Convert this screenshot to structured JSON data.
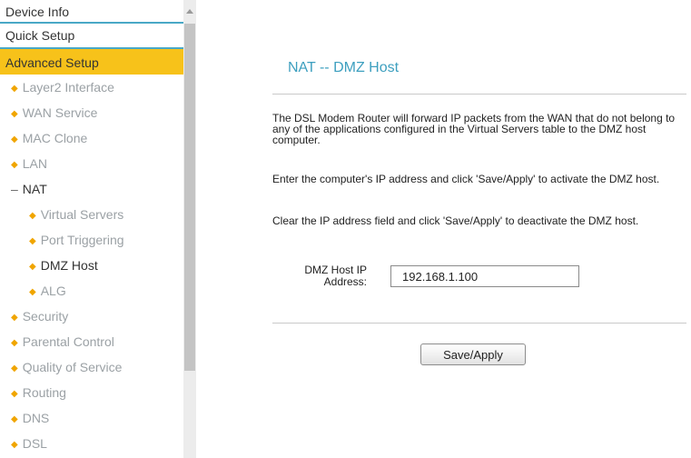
{
  "sidebar": {
    "top_items": [
      "Device Info",
      "Quick Setup",
      "Advanced Setup"
    ],
    "sub_items": [
      "Layer2 Interface",
      "WAN Service",
      "MAC Clone",
      "LAN",
      "NAT",
      "Virtual Servers",
      "Port Triggering",
      "DMZ Host",
      "ALG",
      "Security",
      "Parental Control",
      "Quality of Service",
      "Routing",
      "DNS",
      "DSL"
    ]
  },
  "main": {
    "title": "NAT -- DMZ Host",
    "paragraph1": "The DSL Modem Router will forward IP packets from the WAN that do not belong to any of the applications configured in the Virtual Servers table to the DMZ host computer.",
    "paragraph2": "Enter the computer's IP address and click 'Save/Apply' to activate the DMZ host.",
    "paragraph3": "Clear the IP address field and click 'Save/Apply' to deactivate the DMZ host.",
    "field_label": "DMZ Host IP Address:",
    "ip_value": "192.168.1.100",
    "save_button": "Save/Apply"
  },
  "colors": {
    "accent_blue": "#3d9fbf",
    "active_menu": "#f7c21a",
    "bullet": "#f0a500"
  }
}
